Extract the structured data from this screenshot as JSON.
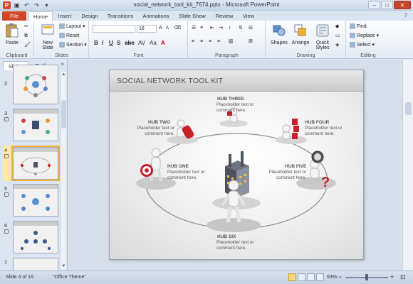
{
  "window": {
    "title": "social_network_tool_kit_7674.pptx  -  Microsoft PowerPoint"
  },
  "tabs": [
    "File",
    "Home",
    "Insert",
    "Design",
    "Transitions",
    "Animations",
    "Slide Show",
    "Review",
    "View"
  ],
  "ribbon": {
    "clipboard": {
      "label": "Clipboard",
      "paste": "Paste"
    },
    "slides": {
      "label": "Slides",
      "new_slide": "New Slide",
      "layout": "Layout",
      "reset": "Reset",
      "section": "Section"
    },
    "font": {
      "label": "Font",
      "size": "16"
    },
    "paragraph": {
      "label": "Paragraph"
    },
    "drawing": {
      "label": "Drawing",
      "shapes": "Shapes",
      "arrange": "Arrange",
      "quick_styles": "Quick Styles"
    },
    "editing": {
      "label": "Editing",
      "find": "Find",
      "replace": "Replace",
      "select": "Select"
    }
  },
  "panel": {
    "tab_slides": "Slides",
    "tab_outline": "Outline",
    "close": "×",
    "slide_numbers": [
      "2",
      "3",
      "4",
      "5",
      "6",
      "7"
    ],
    "selected": "4"
  },
  "slide": {
    "title": "SOCIAL NETWORK TOOL KIT",
    "hubs": {
      "one": {
        "title": "HUB ONE",
        "text": "Placeholder text or comment here."
      },
      "two": {
        "title": "HUB TWO",
        "text": "Placeholder text or comment here."
      },
      "three": {
        "title": "HUB THREE",
        "text": "Placeholder text or comment here."
      },
      "four": {
        "title": "HUB FOUR",
        "text": "Placeholder text or comment here."
      },
      "five": {
        "title": "HUB FIVE",
        "text": "Placeholder text or comment here."
      },
      "six": {
        "title": "HUB SIX",
        "text": "Placeholder text or comment here."
      }
    }
  },
  "status": {
    "slide": "Slide 4 of 16",
    "theme": "\"Office Theme\"",
    "zoom": "63%"
  },
  "colors": {
    "file_tab": "#d24726",
    "accent_red": "#c8202a",
    "selection": "#f2b134"
  }
}
